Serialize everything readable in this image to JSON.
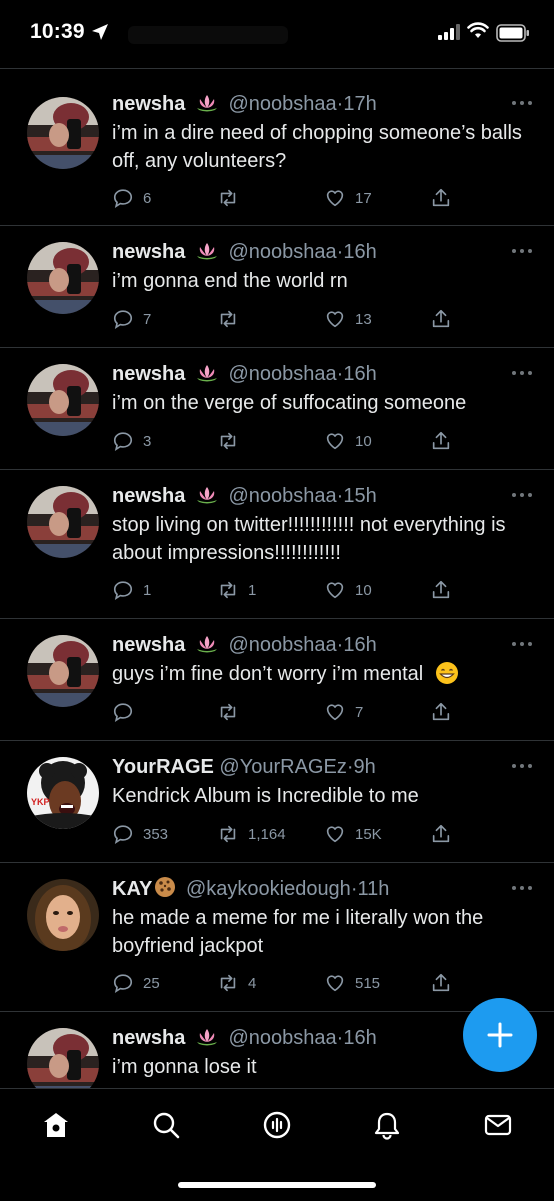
{
  "status_bar": {
    "time": "10:39"
  },
  "tweets": [
    {
      "name": "newsha",
      "handle": "@noobshaa",
      "dot": "·",
      "time": "17h",
      "text": "i’m in a dire need of chopping someone’s balls off, any volunteers?",
      "replies": "6",
      "retweets": "",
      "likes": "17",
      "avatar": "newsha",
      "emoji": "lotus"
    },
    {
      "name": "newsha",
      "handle": "@noobshaa",
      "dot": "·",
      "time": "16h",
      "text": "i’m gonna end the world rn",
      "replies": "7",
      "retweets": "",
      "likes": "13",
      "avatar": "newsha",
      "emoji": "lotus"
    },
    {
      "name": "newsha",
      "handle": "@noobshaa",
      "dot": "·",
      "time": "16h",
      "text": "i’m on the verge of suffocating someone",
      "replies": "3",
      "retweets": "",
      "likes": "10",
      "avatar": "newsha",
      "emoji": "lotus"
    },
    {
      "name": "newsha",
      "handle": "@noobshaa",
      "dot": "·",
      "time": "15h",
      "text": "stop living on twitter!!!!!!!!!!!! not everything is about impressions!!!!!!!!!!!!",
      "replies": "1",
      "retweets": "1",
      "likes": "10",
      "avatar": "newsha",
      "emoji": "lotus"
    },
    {
      "name": "newsha",
      "handle": "@noobshaa",
      "dot": "·",
      "time": "16h",
      "text": "guys i’m fine don’t worry i’m mental",
      "replies": "",
      "retweets": "",
      "likes": "7",
      "avatar": "newsha",
      "emoji": "lotus",
      "trailing_emoji": "grin"
    },
    {
      "name": "YourRAGE",
      "handle": "@YourRAGEz",
      "dot": "·",
      "time": "9h",
      "text": "Kendrick Album is Incredible to me",
      "replies": "353",
      "retweets": "1,164",
      "likes": "15K",
      "avatar": "rage",
      "emoji": ""
    },
    {
      "name": "KAY",
      "handle": "@kaykookiedough",
      "dot": "·",
      "time": "11h",
      "text": "he made a meme for me i literally won the boyfriend jackpot",
      "replies": "25",
      "retweets": "4",
      "likes": "515",
      "avatar": "kay",
      "emoji": "cookie"
    },
    {
      "name": "newsha",
      "handle": "@noobshaa",
      "dot": "·",
      "time": "16h",
      "text": "i’m gonna lose it",
      "replies": "",
      "retweets": "",
      "likes": "",
      "avatar": "newsha",
      "emoji": "lotus"
    }
  ],
  "fab": {
    "icon": "plus-icon"
  },
  "tabbar": [
    {
      "name": "home",
      "icon": "home-icon",
      "active": true
    },
    {
      "name": "search",
      "icon": "search-icon",
      "active": false
    },
    {
      "name": "spaces",
      "icon": "spaces-icon",
      "active": false
    },
    {
      "name": "notifications",
      "icon": "bell-icon",
      "active": false
    },
    {
      "name": "messages",
      "icon": "mail-icon",
      "active": false
    }
  ],
  "colors": {
    "background": "#000000",
    "text": "#e7e9ea",
    "secondary": "#8b98a5",
    "divider": "#2f3336",
    "accent": "#1d9bf0"
  }
}
